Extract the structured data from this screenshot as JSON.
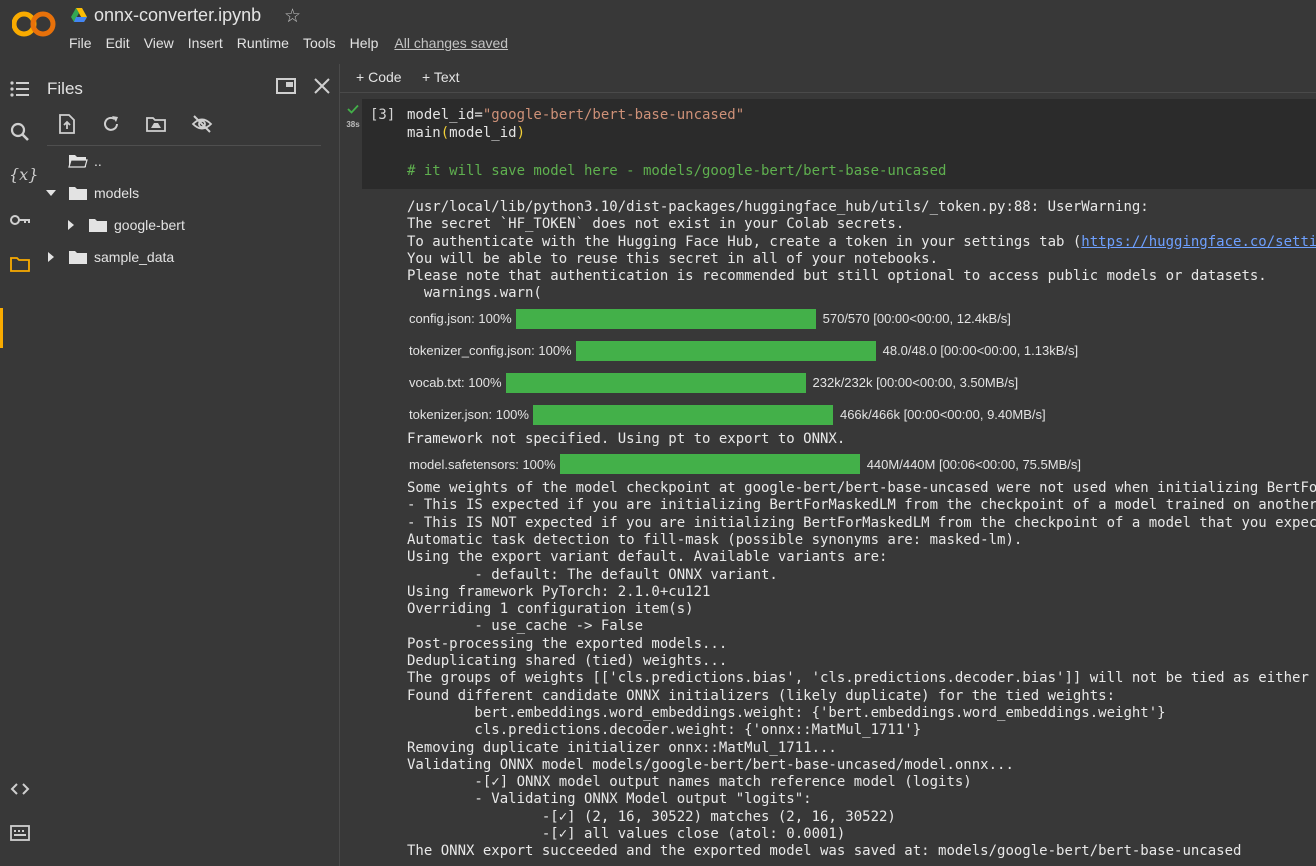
{
  "header": {
    "notebook_title": "onnx-converter.ipynb",
    "logo_text": "CO",
    "menu": [
      "File",
      "Edit",
      "View",
      "Insert",
      "Runtime",
      "Tools",
      "Help"
    ],
    "save_status": "All changes saved"
  },
  "rail": {
    "icons": [
      "table-of-contents-icon",
      "search-icon",
      "variables-icon",
      "secrets-key-icon",
      "files-icon",
      "code-snippets-icon",
      "terminal-icon"
    ],
    "variables_label": "{x}",
    "active": "files-icon"
  },
  "files_panel": {
    "title": "Files",
    "toolbar_icons": [
      "upload-icon",
      "refresh-icon",
      "mount-drive-icon",
      "hide-hidden-files-icon"
    ],
    "tree": [
      {
        "label": "..",
        "level": 0,
        "expandable": false
      },
      {
        "label": "models",
        "level": 0,
        "expandable": true,
        "expanded": true
      },
      {
        "label": "google-bert",
        "level": 1,
        "expandable": true,
        "expanded": false
      },
      {
        "label": "sample_data",
        "level": 0,
        "expandable": true,
        "expanded": false
      }
    ]
  },
  "notebook": {
    "add_code_label": "Code",
    "add_text_label": "Text",
    "cell": {
      "execution_count": "[3]",
      "exec_time": "38s",
      "code": {
        "line1_prefix": "model_id=",
        "line1_string": "\"google-bert/bert-base-uncased\"",
        "line2_fn": "main",
        "line2_open": "(",
        "line2_arg": "model_id",
        "line2_close": ")",
        "comment": "# it will save model here - models/google-bert/bert-base-uncased"
      }
    },
    "output": {
      "warning_lines": [
        "/usr/local/lib/python3.10/dist-packages/huggingface_hub/utils/_token.py:88: UserWarning:",
        "The secret `HF_TOKEN` does not exist in your Colab secrets."
      ],
      "auth_line_prefix": "To authenticate with the Hugging Face Hub, create a token in your settings tab (",
      "auth_link": "https://huggingface.co/settings/tokens",
      "warning_lines_2": [
        "You will be able to reuse this secret in all of your notebooks.",
        "Please note that authentication is recommended but still optional to access public models or datasets.",
        "  warnings.warn("
      ],
      "progress_group_1": [
        {
          "label": "config.json: 100%",
          "progress": 1.0,
          "stats": "570/570 [00:00<00:00, 12.4kB/s]"
        },
        {
          "label": "tokenizer_config.json: 100%",
          "progress": 1.0,
          "stats": "48.0/48.0 [00:00<00:00, 1.13kB/s]"
        },
        {
          "label": "vocab.txt: 100%",
          "progress": 1.0,
          "stats": "232k/232k [00:00<00:00, 3.50MB/s]"
        },
        {
          "label": "tokenizer.json: 100%",
          "progress": 1.0,
          "stats": "466k/466k [00:00<00:00, 9.40MB/s]"
        }
      ],
      "framework_line": "Framework not specified. Using pt to export to ONNX.",
      "progress_group_2": [
        {
          "label": "model.safetensors: 100%",
          "progress": 1.0,
          "stats": "440M/440M [00:06<00:00, 75.5MB/s]"
        }
      ],
      "log_lines": [
        "Some weights of the model checkpoint at google-bert/bert-base-uncased were not used when initializing BertForMaskedLM",
        "- This IS expected if you are initializing BertForMaskedLM from the checkpoint of a model trained on another task",
        "- This IS NOT expected if you are initializing BertForMaskedLM from the checkpoint of a model that you expect",
        "Automatic task detection to fill-mask (possible synonyms are: masked-lm).",
        "Using the export variant default. Available variants are:",
        "        - default: The default ONNX variant.",
        "Using framework PyTorch: 2.1.0+cu121",
        "Overriding 1 configuration item(s)",
        "        - use_cache -> False",
        "Post-processing the exported models...",
        "Deduplicating shared (tied) weights...",
        "The groups of weights [['cls.predictions.bias', 'cls.predictions.decoder.bias']] will not be tied as either",
        "Found different candidate ONNX initializers (likely duplicate) for the tied weights:",
        "        bert.embeddings.word_embeddings.weight: {'bert.embeddings.word_embeddings.weight'}",
        "        cls.predictions.decoder.weight: {'onnx::MatMul_1711'}",
        "Removing duplicate initializer onnx::MatMul_1711...",
        "Validating ONNX model models/google-bert/bert-base-uncased/model.onnx...",
        "        -[✓] ONNX model output names match reference model (logits)",
        "        - Validating ONNX Model output \"logits\":",
        "                -[✓] (2, 16, 30522) matches (2, 16, 30522)",
        "                -[✓] all values close (atol: 0.0001)",
        "The ONNX export succeeded and the exported model was saved at: models/google-bert/bert-base-uncased"
      ]
    }
  },
  "colors": {
    "progress_bar": "#43b049",
    "active_rail": "#f9ab00",
    "link": "#6ea0ff"
  }
}
